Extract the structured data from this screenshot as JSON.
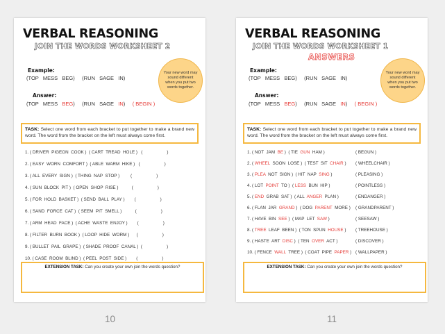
{
  "pages": [
    {
      "title": "VERBAL REASONING",
      "subtitle": "JOIN THE WORDS WORKSHEET 2",
      "example_label": "Example:",
      "example_line": "(TOP   MESS   BEG)     (RUN   SAGE   IN)",
      "answer_label": "Answer:",
      "answer_line": {
        "pre": "(TOP   MESS   ",
        "a": "BEG",
        "mid": ")     (RUN   SAGE   ",
        "b": "IN",
        "post": ")     ",
        "ans": "( BEGIN )"
      },
      "bubble": "Your new word may sound different when you put two words together.",
      "task_label": "TASK:",
      "task_text": " Select one word from each bracket to put together to make a brand new word. The word from the bracket on the left must always come first.",
      "questions": [
        {
          "q": "1. ( DRIVER  PIGEON  COOK )  ( CART  TREAD  HOLE )   (                    )"
        },
        {
          "q": "2. ( EASY  WORN  COMFORT )  ( ABLE  WARM  HIKE )   (                    )"
        },
        {
          "q": "3. ( ALL  EVERY  SIGN )  ( THING  NAP  STOP )         (                    )"
        },
        {
          "q": "4. ( SUN  BLOCK  PIT )  ( OPEN  SHOP  RISE )           (                    )"
        },
        {
          "q": "5. ( FOR  HOLD  BASKET )  ( SEND  BALL  PLAY )        (                    )"
        },
        {
          "q": "6. ( SAND  FORCE  CAT )  ( SEEM  PIT  SMELL )           (                    )"
        },
        {
          "q": "7. ( ARM  HEAD  FACE )  ( ACHE  WASTE  ENJOY )        (                    )"
        },
        {
          "q": "8. ( FILTER  BURN  BOOK )  ( LOOP  HIDE  WORM )      (                    )"
        },
        {
          "q": "9. ( BULLET  PAIL  GRAPE )  ( SHADE  PROOF  CANAL )  (                    )"
        },
        {
          "q": "10. ( CASE  ROOM  BLIND )  ( PEEL  POST  SIDE )        (                    )"
        }
      ],
      "ext_label": "EXTENSION TASK:",
      "ext_text": " Can you create your own join the words question?",
      "page_number": "10"
    },
    {
      "title": "VERBAL REASONING",
      "subtitle": "JOIN THE WORDS WORKSHEET 1",
      "answers_label": "ANSWERS",
      "example_label": "Example:",
      "example_line": "(TOP   MESS   BEG)     (RUN   SAGE   IN)",
      "answer_label": "Answer:",
      "answer_line": {
        "pre": "(TOP   MESS   ",
        "a": "BEG",
        "mid": ")     (RUN   SAGE   ",
        "b": "IN",
        "post": ")     ",
        "ans": "( BEGIN )"
      },
      "bubble": "Your new word may sound different when you put two words together.",
      "task_label": "TASK:",
      "task_text": " Select one word from each bracket to put together to make a brand new word. The word from the bracket on the left must always come first.",
      "answers": [
        {
          "p": "1. ( NOT  JAM  ",
          "r1": "BE",
          "m": " )  ( TIE  ",
          "r2": "GUN",
          "e": "  HAM )",
          "ans": "( BEGUN )"
        },
        {
          "p": "2. ( ",
          "r1": "WHEEL",
          "m": "  SOON  LOSE )  ( TEST  SIT  ",
          "r2": "CHAIR",
          "e": " )",
          "ans": "( WHEELCHAIR )"
        },
        {
          "p": "3. ( ",
          "r1": "PLEA",
          "m": "  NOT  SIGN )  ( HIT  NAP  ",
          "r2": "SING",
          "e": " )",
          "ans": "( PLEASING )"
        },
        {
          "p": "4. ( LOT  ",
          "r1": "POINT",
          "m": "  TO )  ( ",
          "r2": "LESS",
          "e": "  BUN  HIP )",
          "ans": "( POINTLESS )"
        },
        {
          "p": "5. ( ",
          "r1": "END",
          "m": "  GRAB  SAT )  ( ALL  ",
          "r2": "ANGER",
          "e": "  PLAN )",
          "ans": "( ENDANGER )"
        },
        {
          "p": "6. ( FLAN  JAR  ",
          "r1": "GRAND",
          "m": " )  ( DOG  ",
          "r2": "PARENT",
          "e": "  MORE )",
          "ans": "( GRANDPARENT )"
        },
        {
          "p": "7. ( HAVE  BIN  ",
          "r1": "SEE",
          "m": " )  ( MAP  LET  ",
          "r2": "SAW",
          "e": " )",
          "ans": "( SEESAW )"
        },
        {
          "p": "8. ( ",
          "r1": "TREE",
          "m": "  LEAF  BEEN )  ( TON  SPUN  ",
          "r2": "HOUSE",
          "e": " )",
          "ans": "( TREEHOUSE )"
        },
        {
          "p": "9. ( HASTE  ART  ",
          "r1": "DISC",
          "m": " )  ( TEN  ",
          "r2": "OVER",
          "e": "  ACT )",
          "ans": "( DISCOVER )"
        },
        {
          "p": "10. ( FENCE  ",
          "r1": "WALL",
          "m": "  TREE )  ( COAT  PIPE  ",
          "r2": "PAPER",
          "e": " )",
          "ans": "( WALLPAPER )"
        }
      ],
      "ext_label": "EXTENSION TASK:",
      "ext_text": " Can you create your own join the words question?",
      "page_number": "11"
    }
  ]
}
